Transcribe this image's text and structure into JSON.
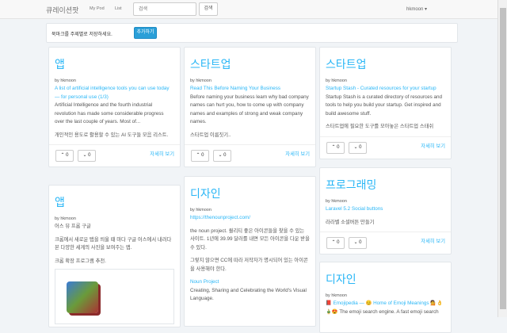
{
  "nav": {
    "brand": "큐레이션팟",
    "links": [
      "My Pod",
      "List"
    ],
    "search_placeholder": "검색",
    "search_button": "검색",
    "user": "hkmoon ▾"
  },
  "banner": {
    "text": "북마크를 주제별로 저장하세요.",
    "add_button": "추가하기"
  },
  "cards": [
    {
      "title": "앱",
      "by": "by hkmoon",
      "link": "A list of artificial intelligence tools you can use today — for personal use (1/3)",
      "desc": "Artificial Intelligence and the fourth industrial revolution has made some considerable progress over the last couple of years. Most of...",
      "note": "개인적인 용도로 활용할 수 있는 AI 도구들 모음 리스트.",
      "up": "0",
      "down": "0",
      "more": "자세히 보기"
    },
    {
      "title": "스타트업",
      "by": "by hkmoon",
      "link": "Read This Before Naming Your Business",
      "desc": "Before naming your business learn why bad company names can hurt you, how to come up with company names and examples of strong and weak company names.",
      "note": "스타트업 이름짓기..",
      "up": "0",
      "down": "0",
      "more": "자세히 보기"
    },
    {
      "title": "스타트업",
      "by": "by hkmoon",
      "link": "Startup Stash - Curated resources for your startup",
      "desc": "Startup Stash is a curated directory of resources and tools to help you build your startup. Get inspired and build awesome stuff.",
      "note": "스타트업에 필요한 도구를 모아놓은 스타트업 스태쉬",
      "up": "0",
      "down": "0",
      "more": "자세히 보기"
    },
    {
      "title": "앱",
      "by": "by hkmoon",
      "line1": "어스 뷰 프롬 구글",
      "desc": "크롬에서 새로운 탭을 띄울 때 마다 구글 어스에서 내려다 본 다양한 세계의 사진을 보여주는 앱.",
      "note": "크롬 확장 프로그램 추천."
    },
    {
      "title": "디자인",
      "by": "by hkmoon",
      "link": "https://thenounproject.com/",
      "desc": "the noun project. 퀄리티 좋은 아이콘들을 찾을 수 있는 사이트. 1년에 39.99 달러를 내면 모든 아이콘을 다운 받을 수 있다.",
      "note": "그렇지 않으면 CC에 따라 저작자가 명시되어 있는 아이콘을 사용해야 한다.",
      "link2": "Noun Project",
      "desc2": "Creating, Sharing and Celebrating the World's Visual Language."
    },
    {
      "title": "프로그래밍",
      "by": "by hkmoon",
      "link": "Laravel 5.2 Social buttons",
      "note": "라라벨 소셜버튼 만들기",
      "up": "0",
      "down": "0",
      "more": "자세히 보기"
    },
    {
      "title": "디자인",
      "by": "by hkmoon",
      "link": "📕 Emojipedia — 😊 Home of Emoji Meanings 💁👌",
      "desc": "🎍😍 The emoji search engine. A fast emoji search"
    }
  ]
}
